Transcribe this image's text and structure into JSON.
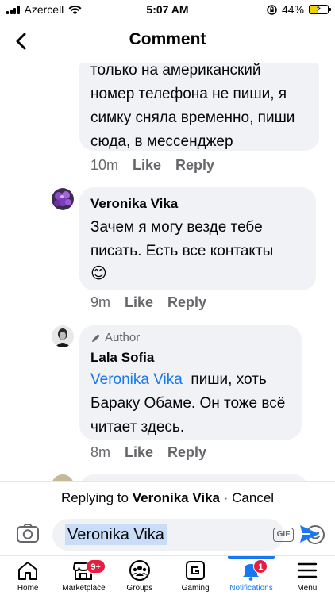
{
  "status_bar": {
    "carrier": "Azercell",
    "time": "5:07 AM",
    "battery": "44%",
    "battery_level": 0.44
  },
  "header": {
    "title": "Comment"
  },
  "comments": [
    {
      "text": "только на американский номер телефона не пиши, я симку сняла временно, пиши сюда, в мессенджер",
      "time": "10m",
      "like": "Like",
      "reply": "Reply"
    },
    {
      "author": "Veronika Vika",
      "text": "Зачем я могу везде тебе писать. Есть все контакты",
      "emoji": "😊",
      "time": "9m",
      "like": "Like",
      "reply": "Reply"
    },
    {
      "badge": "Author",
      "author": "Lala Sofia",
      "mention": "Veronika Vika",
      "text": "пиши, хоть Бараку Обаме. Он тоже всё читает здесь.",
      "time": "8m",
      "like": "Like",
      "reply": "Reply"
    }
  ],
  "reply_bar": {
    "prefix": "Replying to",
    "name": "Veronika Vika",
    "separator": "·",
    "cancel": "Cancel"
  },
  "composer": {
    "value": "Veronika Vika",
    "gif_label": "GIF"
  },
  "tabs": [
    {
      "label": "Home",
      "icon": "home-icon"
    },
    {
      "label": "Marketplace",
      "icon": "marketplace-icon",
      "badge": "9+"
    },
    {
      "label": "Groups",
      "icon": "groups-icon"
    },
    {
      "label": "Gaming",
      "icon": "gaming-icon"
    },
    {
      "label": "Notifications",
      "icon": "bell-icon",
      "badge": "1",
      "active": true
    },
    {
      "label": "Menu",
      "icon": "menu-icon"
    }
  ],
  "colors": {
    "accent": "#1877f2",
    "bubble": "#f0f2f5",
    "badge": "#e41e3f",
    "muted": "#65676b"
  }
}
